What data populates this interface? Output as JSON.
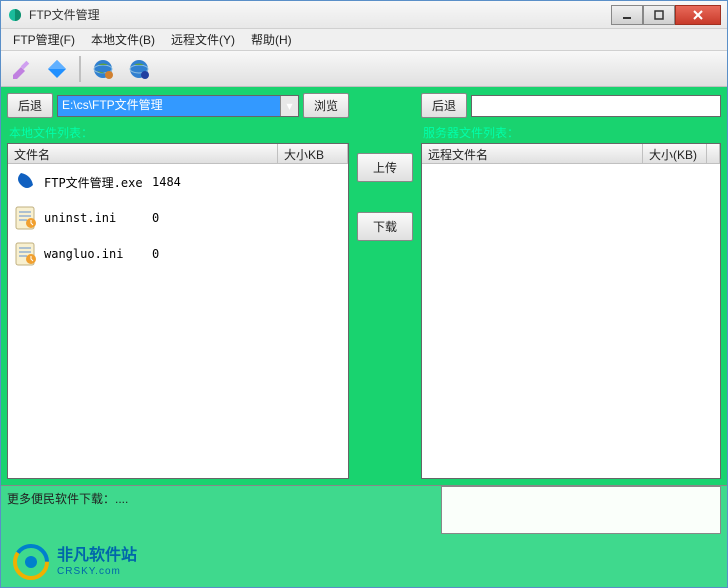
{
  "titlebar": {
    "title": "FTP文件管理"
  },
  "menu": {
    "items": [
      {
        "label": "FTP管理(F)"
      },
      {
        "label": "本地文件(B)"
      },
      {
        "label": "远程文件(Y)"
      },
      {
        "label": "帮助(H)"
      }
    ]
  },
  "colors": {
    "accent_green": "#19d36f",
    "path_highlight": "#3399ff",
    "list_label": "#00ffaa"
  },
  "local": {
    "back_label": "后退",
    "path_value": "E:\\cs\\FTP文件管理",
    "browse_label": "浏览",
    "list_label": "本地文件列表：",
    "columns": {
      "name": "文件名",
      "size": "大小KB"
    },
    "files": [
      {
        "icon": "telecom",
        "name": "FTP文件管理.exe",
        "size": "1484"
      },
      {
        "icon": "ini",
        "name": "uninst.ini",
        "size": "0"
      },
      {
        "icon": "ini",
        "name": "wangluo.ini",
        "size": "0"
      }
    ]
  },
  "middle": {
    "upload_label": "上传",
    "download_label": "下载"
  },
  "remote": {
    "back_label": "后退",
    "path_value": "",
    "list_label": "服务器文件列表：",
    "columns": {
      "name": "远程文件名",
      "size": "大小(KB)"
    }
  },
  "log": {
    "text": "更多便民软件下载：...."
  },
  "footer": {
    "site_cn": "非凡软件站",
    "site_en": "CRSKY.com"
  }
}
